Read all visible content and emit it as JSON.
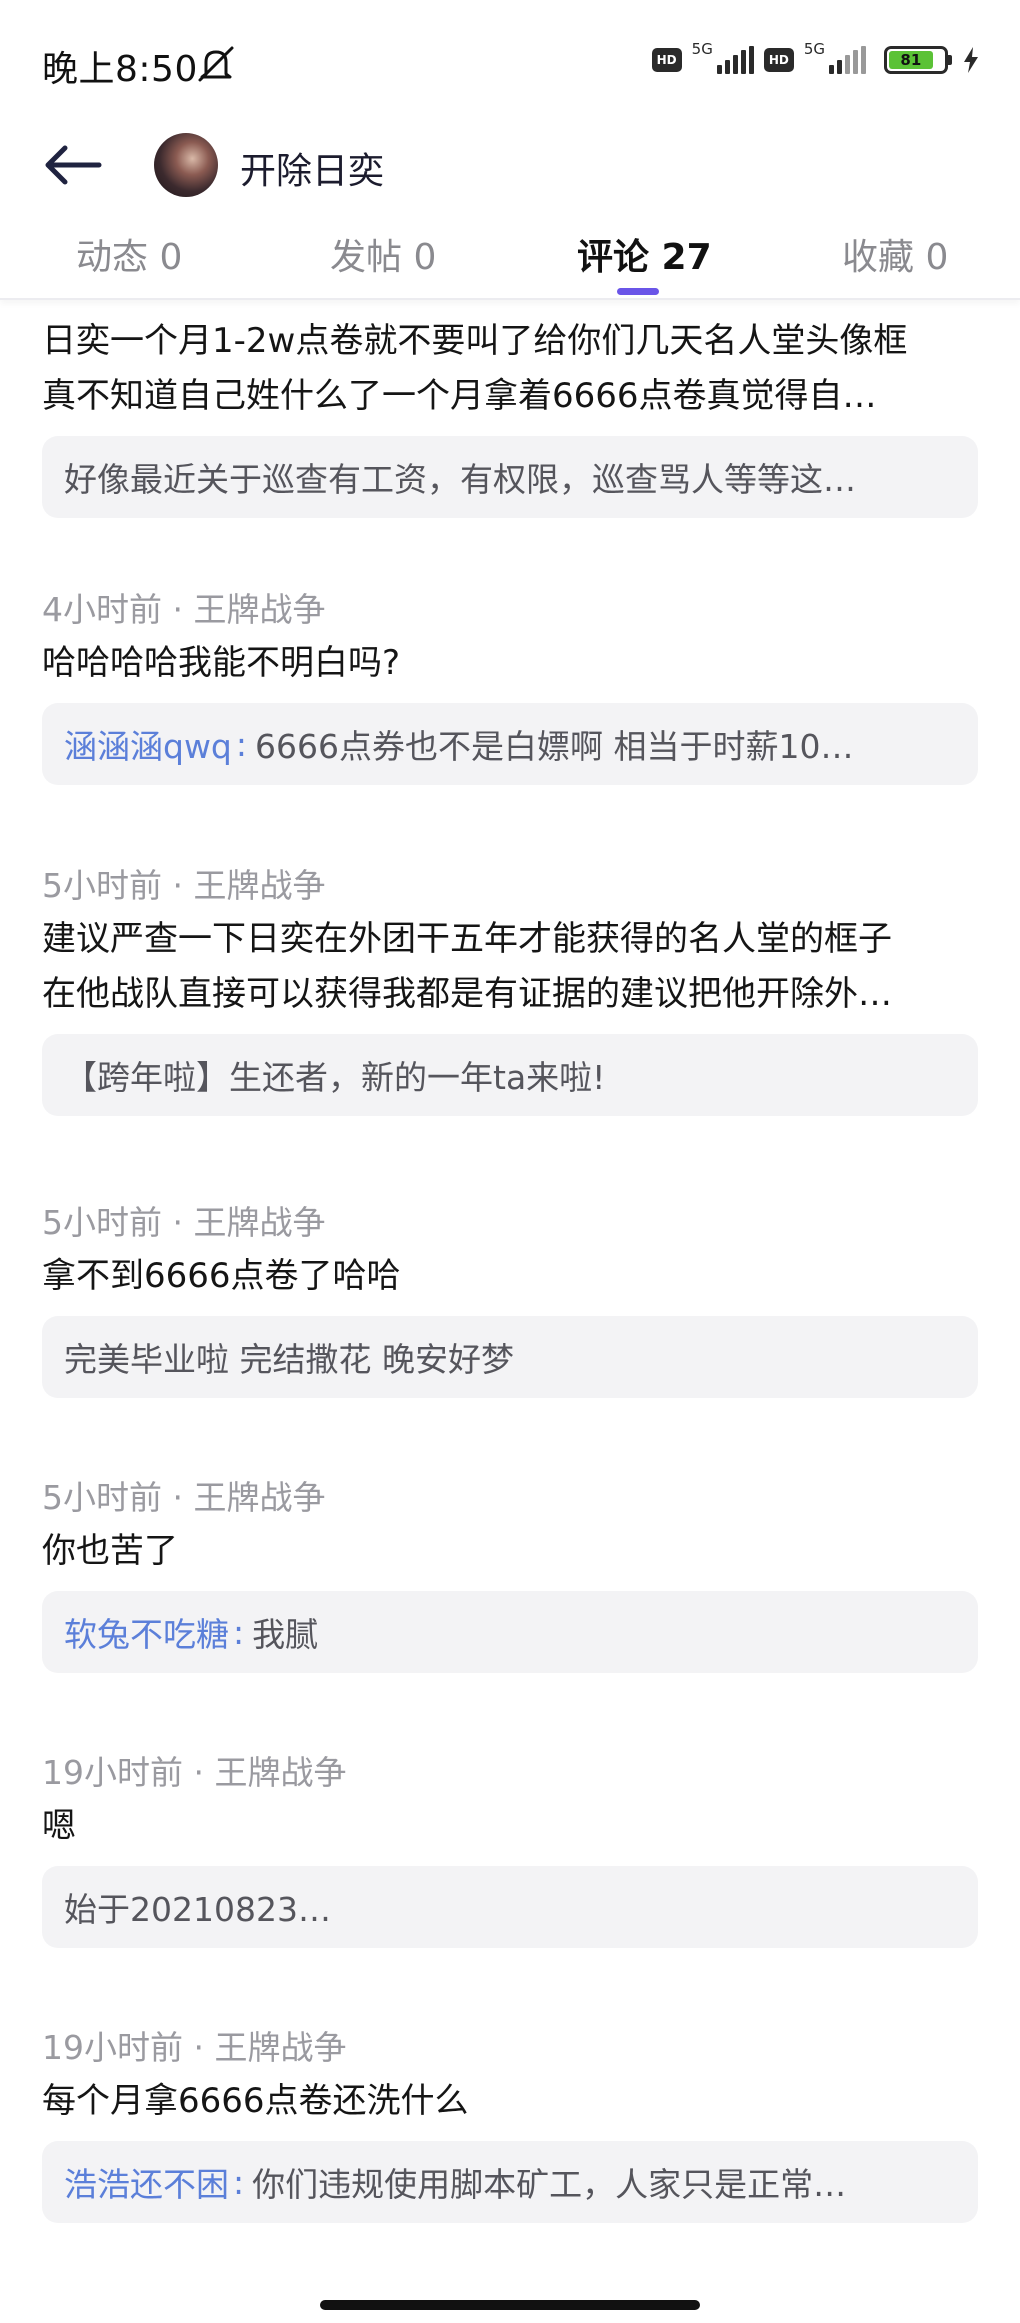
{
  "status_bar": {
    "time": "晚上8:50",
    "hd1": "HD",
    "net1": "5G",
    "hd2": "HD",
    "net2": "5G",
    "battery_level": 81,
    "battery_label": "81",
    "battery_color": "#5bc236"
  },
  "header": {
    "title": "开除日奕"
  },
  "tabs": [
    {
      "label": "动态 0"
    },
    {
      "label": "发帖 0"
    },
    {
      "label": "评论 27"
    },
    {
      "label": "收藏 0"
    }
  ],
  "accent_color": "#6a55e8",
  "link_color": "#5b7fd9",
  "comments": [
    {
      "meta": "",
      "lines": [
        "日奕一个月1-2w点卷就不要叫了给你们几天名人堂头像框",
        "真不知道自己姓什么了一个月拿着6666点卷真觉得自…"
      ],
      "quote_author": "",
      "quote_text": "好像最近关于巡查有工资，有权限，巡查骂人等等这…"
    },
    {
      "meta": "4小时前 · 王牌战争",
      "lines": [
        "哈哈哈哈我能不明白吗?"
      ],
      "quote_author": "涵涵涵qwq",
      "quote_text": "6666点券也不是白嫖啊 相当于时薪10…"
    },
    {
      "meta": "5小时前 · 王牌战争",
      "lines": [
        "建议严查一下日奕在外团干五年才能获得的名人堂的框子",
        "在他战队直接可以获得我都是有证据的建议把他开除外…"
      ],
      "quote_author": "",
      "quote_text": "【跨年啦】生还者，新的一年ta来啦!"
    },
    {
      "meta": "5小时前 · 王牌战争",
      "lines": [
        "拿不到6666点卷了哈哈"
      ],
      "quote_author": "",
      "quote_text": "完美毕业啦 完结撒花 晚安好梦"
    },
    {
      "meta": "5小时前 · 王牌战争",
      "lines": [
        "你也苦了"
      ],
      "quote_author": "软兔不吃糖",
      "quote_text": "我腻"
    },
    {
      "meta": "19小时前 · 王牌战争",
      "lines": [
        "嗯"
      ],
      "quote_author": "",
      "quote_text": "始于20210823…"
    },
    {
      "meta": "19小时前 · 王牌战争",
      "lines": [
        "每个月拿6666点卷还洗什么"
      ],
      "quote_author": "浩浩还不困",
      "quote_text": "你们违规使用脚本矿工，人家只是正常…"
    }
  ]
}
